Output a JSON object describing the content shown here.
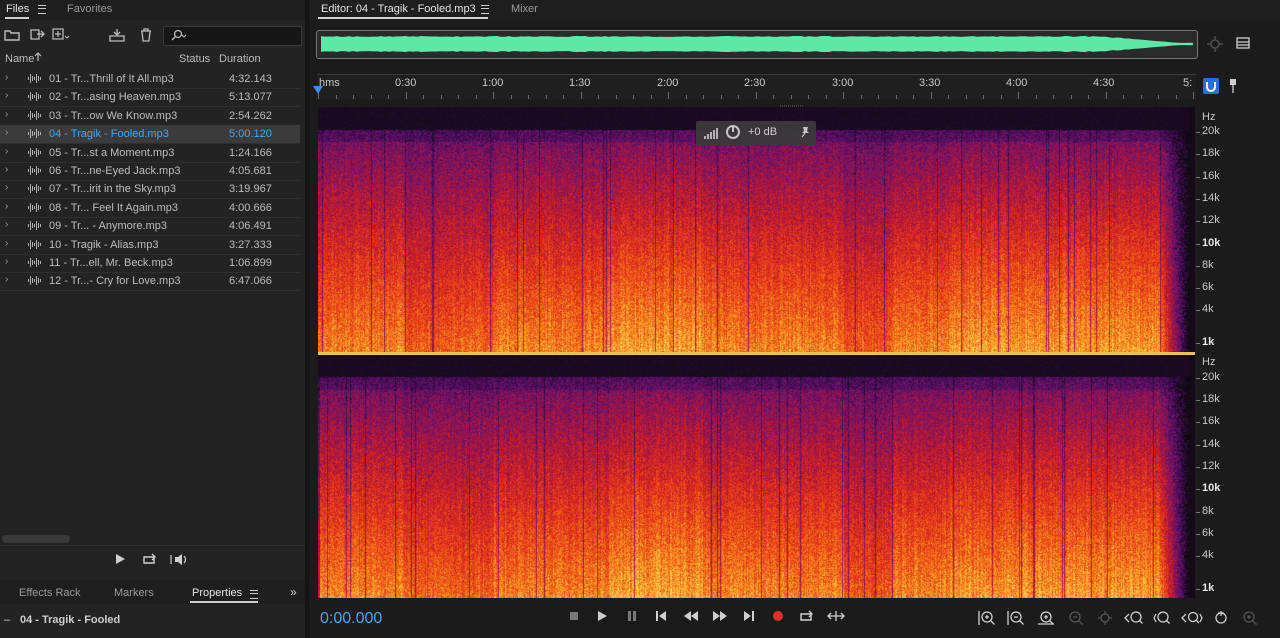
{
  "left_panel": {
    "tabs": [
      {
        "label": "Files",
        "active": true
      },
      {
        "label": "Favorites",
        "active": false
      }
    ],
    "columns": {
      "name": "Name",
      "status": "Status",
      "duration": "Duration"
    },
    "files": [
      {
        "name": "01 - Tr...Thrill of It All.mp3",
        "duration": "4:32.143",
        "selected": false
      },
      {
        "name": "02 - Tr...asing Heaven.mp3",
        "duration": "5:13.077",
        "selected": false
      },
      {
        "name": "03 - Tr...ow We Know.mp3",
        "duration": "2:54.262",
        "selected": false
      },
      {
        "name": "04 - Tragik - Fooled.mp3",
        "duration": "5:00.120",
        "selected": true
      },
      {
        "name": "05 - Tr...st a Moment.mp3",
        "duration": "1:24.166",
        "selected": false
      },
      {
        "name": "06 - Tr...ne-Eyed Jack.mp3",
        "duration": "4:05.681",
        "selected": false
      },
      {
        "name": "07 - Tr...irit in the Sky.mp3",
        "duration": "3:19.967",
        "selected": false
      },
      {
        "name": "08 - Tr... Feel It Again.mp3",
        "duration": "4:00.666",
        "selected": false
      },
      {
        "name": "09 - Tr... - Anymore.mp3",
        "duration": "4:06.491",
        "selected": false
      },
      {
        "name": "10 - Tragik - Alias.mp3",
        "duration": "3:27.333",
        "selected": false
      },
      {
        "name": "11 - Tr...ell, Mr. Beck.mp3",
        "duration": "1:06.899",
        "selected": false
      },
      {
        "name": "12 - Tr...- Cry for Love.mp3",
        "duration": "6:47.066",
        "selected": false
      }
    ],
    "bottom_tabs": [
      {
        "label": "Effects Rack",
        "active": false
      },
      {
        "label": "Markers",
        "active": false
      },
      {
        "label": "Properties",
        "active": true
      }
    ],
    "properties_title": "04 - Tragik - Fooled"
  },
  "editor": {
    "tab_label": "Editor: 04 - Tragik - Fooled.mp3",
    "mixer_label": "Mixer",
    "ruler_ticks": [
      "hms",
      "0:30",
      "1:00",
      "1:30",
      "2:00",
      "2:30",
      "3:00",
      "3:30",
      "4:00",
      "4:30",
      "5:"
    ],
    "hz_labels_top": [
      "Hz",
      "20k",
      "18k",
      "16k",
      "14k",
      "12k",
      "10k",
      "8k",
      "6k",
      "4k",
      "1k"
    ],
    "hz_labels_bottom": [
      "Hz",
      "20k",
      "18k",
      "16k",
      "14k",
      "12k",
      "10k",
      "8k",
      "6k",
      "4k",
      "1k"
    ],
    "hud_db": "+0 dB",
    "timecode": "0:00.000"
  },
  "colors": {
    "accent": "#3fa9f5",
    "waveform": "#5ee8a8",
    "spectrogram_hot": "#ffd060",
    "spectrogram_mid": "#e03020",
    "spectrogram_low": "#6a1a6a"
  }
}
